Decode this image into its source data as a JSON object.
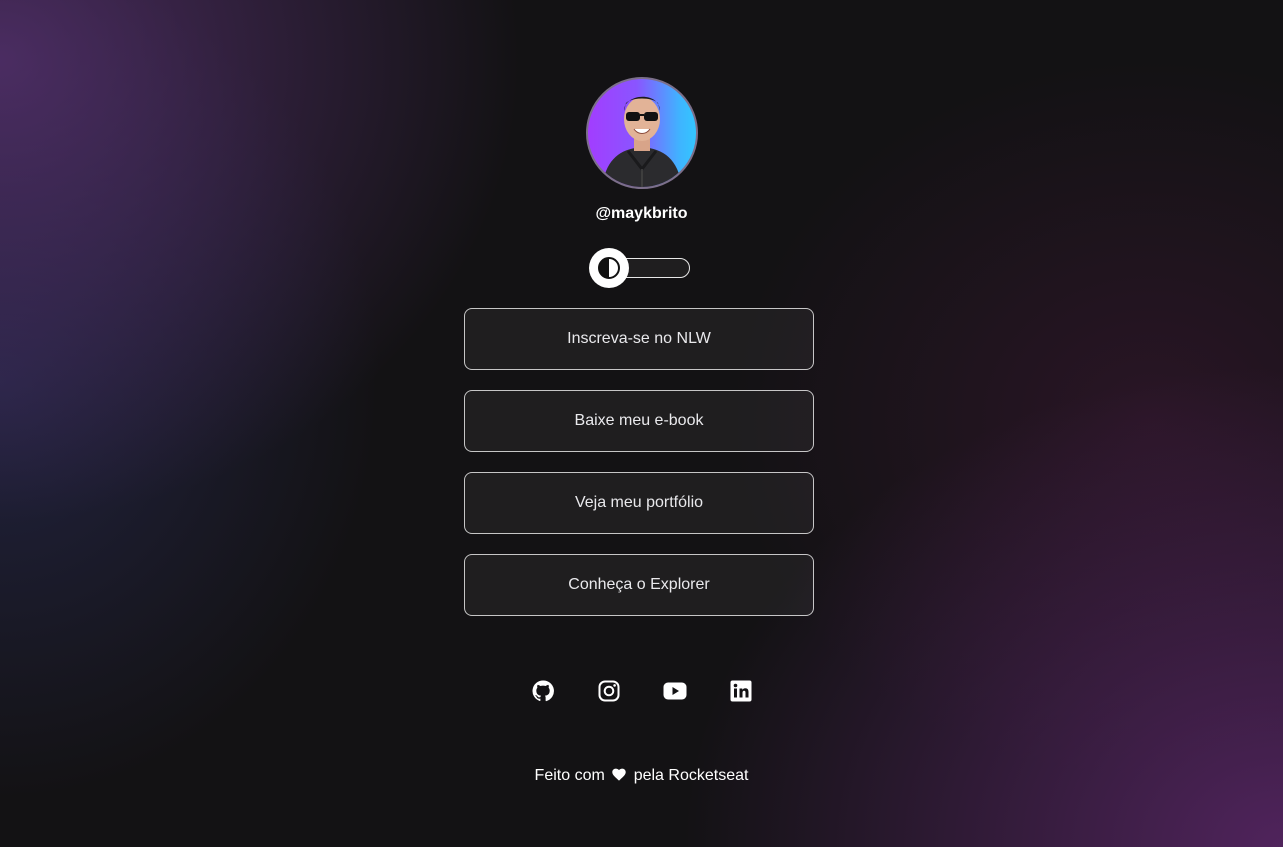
{
  "profile": {
    "username": "@maykbrito",
    "avatar_icon": "profile-photo"
  },
  "theme_switch": {
    "icon": "half-circle-contrast-icon",
    "state": "dark"
  },
  "links": [
    {
      "label": "Inscreva-se no NLW"
    },
    {
      "label": "Baixe meu e-book"
    },
    {
      "label": "Veja meu portfólio"
    },
    {
      "label": "Conheça o Explorer"
    }
  ],
  "socials": [
    {
      "icon": "github-icon"
    },
    {
      "icon": "instagram-icon"
    },
    {
      "icon": "youtube-icon"
    },
    {
      "icon": "linkedin-icon"
    }
  ],
  "footer": {
    "prefix": "Feito com",
    "icon": "heart-icon",
    "suffix": "pela Rocketseat"
  },
  "colors": {
    "background": "#131214",
    "text": "#ffffff",
    "button_border": "#ffffff"
  }
}
